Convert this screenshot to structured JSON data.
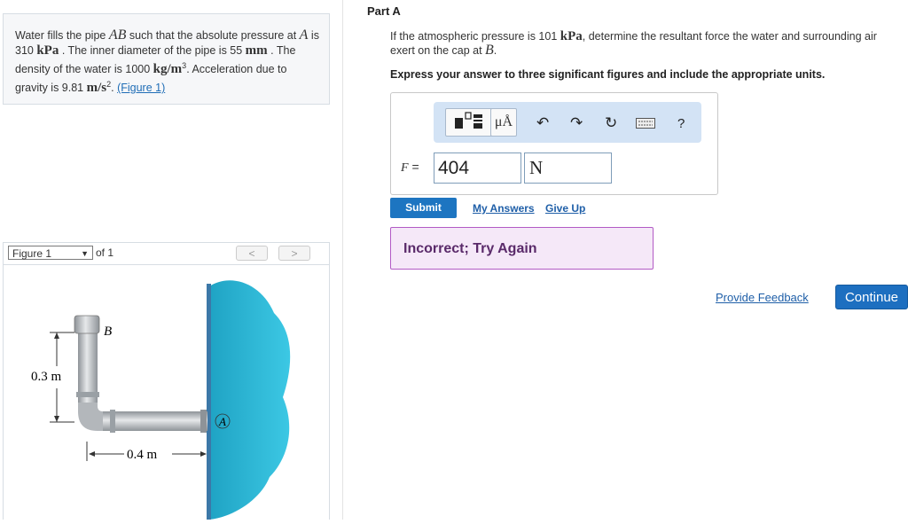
{
  "problem": {
    "t1": "Water fills the pipe ",
    "ab": "AB",
    "t2": " such that the absolute pressure at ",
    "a": "A",
    "t3": " is 310 ",
    "kpa": "kPa",
    "t4": " . The inner diameter of the pipe is 55 ",
    "mm": "mm",
    "t5": " . The density of the water is 1000 ",
    "density_unit": "kg/m",
    "t6": ". Acceleration due to gravity is 9.81 ",
    "g_unit": "m/s",
    "t7": ". ",
    "figure_link": "(Figure 1)"
  },
  "figure": {
    "select_label": "Figure 1",
    "of_label": "of 1",
    "prev": "<",
    "next": ">",
    "label_b": "B",
    "label_a": "A",
    "dim_vertical": "0.3 m",
    "dim_horizontal": "0.4 m",
    "colors": {
      "water": "#2ab7d6",
      "pipe": "#b8bcc0"
    }
  },
  "part": {
    "title": "Part A",
    "q1": "If the atmospheric pressure is 101 ",
    "q_kpa": "kPa",
    "q2": ", determine the resultant force the water and surrounding air exert on the cap at ",
    "q_b": "B",
    "q3": ".",
    "instructions": "Express your answer to three significant figures and include the appropriate units."
  },
  "toolbar": {
    "units_label": "μÅ",
    "help": "?",
    "icons": [
      "templates-icon",
      "units-icon",
      "undo-icon",
      "redo-icon",
      "reset-icon",
      "keyboard-icon",
      "help-icon"
    ]
  },
  "answer": {
    "label": "F =",
    "value": "404",
    "unit": "N"
  },
  "actions": {
    "submit": "Submit",
    "my_answers": "My Answers",
    "give_up": "Give Up"
  },
  "feedback": {
    "text": "Incorrect; Try Again"
  },
  "footer": {
    "provide_feedback": "Provide Feedback",
    "continue": "Continue"
  }
}
